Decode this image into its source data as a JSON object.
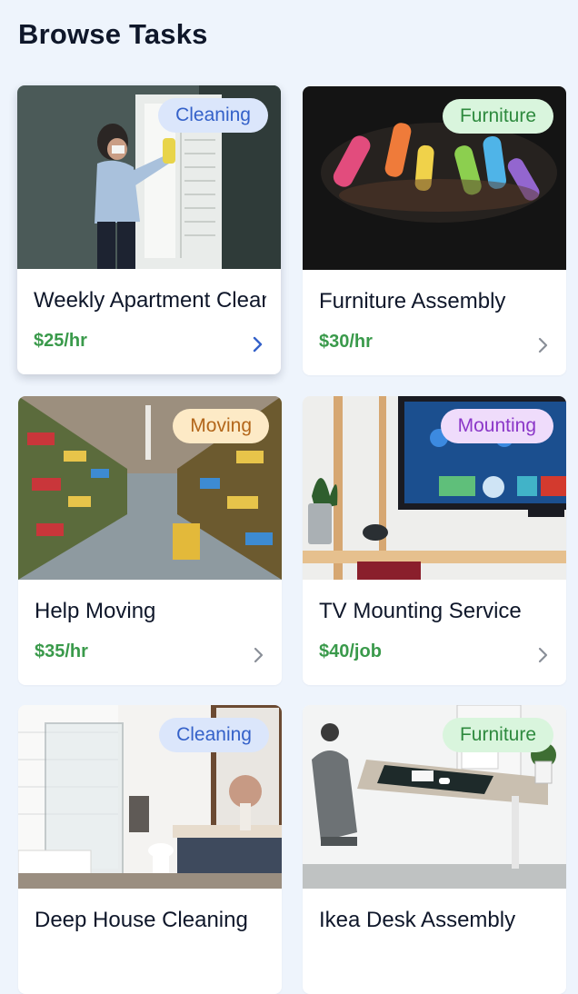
{
  "header": {
    "title": "Browse Tasks"
  },
  "tasks": [
    {
      "title": "Weekly Apartment Cleaning",
      "price": "$25/hr",
      "category": "Cleaning",
      "icon": "chevron-right-icon"
    },
    {
      "title": "Furniture Assembly",
      "price": "$30/hr",
      "category": "Furniture",
      "icon": "chevron-right-icon"
    },
    {
      "title": "Help Moving",
      "price": "$35/hr",
      "category": "Moving",
      "icon": "chevron-right-icon"
    },
    {
      "title": "TV Mounting Service",
      "price": "$40/job",
      "category": "Mounting",
      "icon": "chevron-right-icon"
    },
    {
      "title": "Deep House Cleaning",
      "price": "",
      "category": "Cleaning",
      "icon": "chevron-right-icon"
    },
    {
      "title": "Ikea Desk Assembly",
      "price": "",
      "category": "Furniture",
      "icon": "chevron-right-icon"
    }
  ],
  "colors": {
    "page_background": "#eef4fc",
    "price_green": "#3a9a4b",
    "cleaning_badge": "#dbe6fb",
    "furniture_badge": "#d9f5dd",
    "moving_badge": "#fdeac6",
    "mounting_badge": "#efdcfb"
  }
}
